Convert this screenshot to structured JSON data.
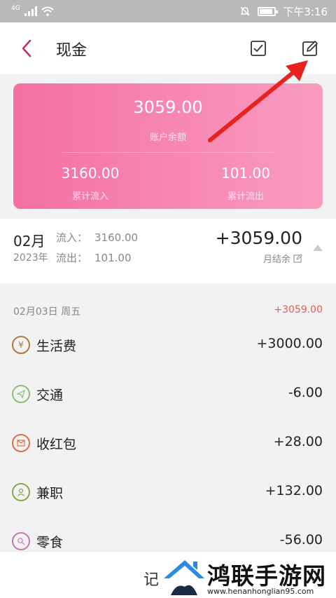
{
  "status_bar": {
    "network": "4G",
    "time": "下午3:16"
  },
  "header": {
    "title": "现金"
  },
  "card": {
    "total": "3059.00",
    "total_label": "账户余额",
    "inflow": "3160.00",
    "inflow_label": "累计流入",
    "outflow": "101.00",
    "outflow_label": "累计流出"
  },
  "month_summary": {
    "month": "02月",
    "year": "2023年",
    "in_label": "流入：",
    "in_value": "3160.00",
    "out_label": "流出：",
    "out_value": "101.00",
    "balance": "+3059.00",
    "balance_label": "月结余"
  },
  "day": {
    "date": "02月03日 周五",
    "total": "+3059.00"
  },
  "transactions": [
    {
      "name": "生活费",
      "amount": "+3000.00",
      "icon": "yuan-icon",
      "color": "#b07a3a"
    },
    {
      "name": "交通",
      "amount": "-6.00",
      "icon": "paper-plane-icon",
      "color": "#8cbf7a"
    },
    {
      "name": "收红包",
      "amount": "+28.00",
      "icon": "envelope-icon",
      "color": "#d9704e"
    },
    {
      "name": "兼职",
      "amount": "+132.00",
      "icon": "person-icon",
      "color": "#8aa84a"
    },
    {
      "name": "零食",
      "amount": "-56.00",
      "icon": "lollipop-icon",
      "color": "#c47ab0"
    }
  ],
  "bottom_bar": {
    "label": "记"
  },
  "watermark": {
    "title": "鸿联手游网",
    "url": "www.henanhonglian95.com"
  },
  "colors": {
    "accent": "#f46fa2",
    "back": "#c0305a",
    "arrow": "#e8231e"
  }
}
